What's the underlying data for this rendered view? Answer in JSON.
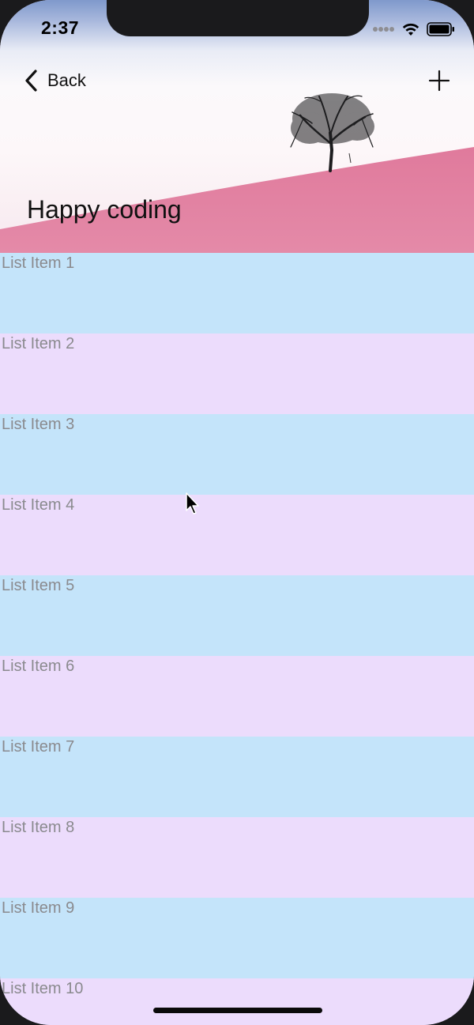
{
  "status_bar": {
    "time": "2:37",
    "signal_icon": "signal-dots-icon",
    "wifi_icon": "wifi-icon",
    "battery_icon": "battery-icon"
  },
  "nav": {
    "back_label": "Back",
    "back_icon": "chevron-left-icon",
    "add_icon": "plus-icon"
  },
  "header": {
    "title": "Happy coding"
  },
  "colors": {
    "row_odd": "#c4e4fa",
    "row_even": "#ecdcfc",
    "row_text": "#8a8a8e",
    "field": "#e892ad"
  },
  "list": {
    "items": [
      {
        "label": "List Item 1"
      },
      {
        "label": "List Item 2"
      },
      {
        "label": "List Item 3"
      },
      {
        "label": "List Item 4"
      },
      {
        "label": "List Item 5"
      },
      {
        "label": "List Item 6"
      },
      {
        "label": "List Item 7"
      },
      {
        "label": "List Item 8"
      },
      {
        "label": "List Item 9"
      },
      {
        "label": "List Item 10"
      }
    ]
  }
}
